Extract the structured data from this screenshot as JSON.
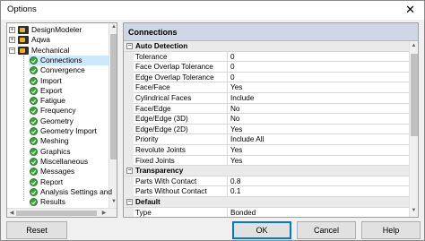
{
  "window": {
    "title": "Options",
    "close_glyph": "✕"
  },
  "tree": {
    "items": [
      {
        "label": "DesignModeler",
        "level": 0,
        "icon": "folder-icon",
        "expander": "+"
      },
      {
        "label": "Aqwa",
        "level": 0,
        "icon": "folder-icon",
        "expander": "+"
      },
      {
        "label": "Mechanical",
        "level": 0,
        "icon": "folder-icon",
        "expander": "−"
      },
      {
        "label": "Connections",
        "level": 1,
        "icon": "check-icon",
        "selected": true
      },
      {
        "label": "Convergence",
        "level": 1,
        "icon": "check-icon"
      },
      {
        "label": "Import",
        "level": 1,
        "icon": "check-icon"
      },
      {
        "label": "Export",
        "level": 1,
        "icon": "check-icon"
      },
      {
        "label": "Fatigue",
        "level": 1,
        "icon": "check-icon"
      },
      {
        "label": "Frequency",
        "level": 1,
        "icon": "check-icon"
      },
      {
        "label": "Geometry",
        "level": 1,
        "icon": "check-icon"
      },
      {
        "label": "Geometry Import",
        "level": 1,
        "icon": "check-icon"
      },
      {
        "label": "Meshing",
        "level": 1,
        "icon": "check-icon"
      },
      {
        "label": "Graphics",
        "level": 1,
        "icon": "check-icon"
      },
      {
        "label": "Miscellaneous",
        "level": 1,
        "icon": "check-icon"
      },
      {
        "label": "Messages",
        "level": 1,
        "icon": "check-icon"
      },
      {
        "label": "Report",
        "level": 1,
        "icon": "check-icon"
      },
      {
        "label": "Analysis Settings and",
        "level": 1,
        "icon": "check-icon"
      },
      {
        "label": "Results",
        "level": 1,
        "icon": "check-icon"
      }
    ]
  },
  "panel": {
    "title": "Connections",
    "rows": [
      {
        "type": "group",
        "label": "Auto Detection",
        "expander": "−"
      },
      {
        "type": "prop",
        "name": "Tolerance",
        "value": "0"
      },
      {
        "type": "prop",
        "name": "Face Overlap Tolerance",
        "value": "0"
      },
      {
        "type": "prop",
        "name": "Edge Overlap Tolerance",
        "value": "0"
      },
      {
        "type": "prop",
        "name": "Face/Face",
        "value": "Yes"
      },
      {
        "type": "prop",
        "name": "Cylindrical Faces",
        "value": "Include"
      },
      {
        "type": "prop",
        "name": "Face/Edge",
        "value": "No"
      },
      {
        "type": "prop",
        "name": "Edge/Edge (3D)",
        "value": "No"
      },
      {
        "type": "prop",
        "name": "Edge/Edge (2D)",
        "value": "Yes"
      },
      {
        "type": "prop",
        "name": "Priority",
        "value": "Include All"
      },
      {
        "type": "prop",
        "name": "Revolute Joints",
        "value": "Yes"
      },
      {
        "type": "prop",
        "name": "Fixed Joints",
        "value": "Yes"
      },
      {
        "type": "group",
        "label": "Transparency",
        "expander": "−"
      },
      {
        "type": "prop",
        "name": "Parts With Contact",
        "value": "0.8"
      },
      {
        "type": "prop",
        "name": "Parts Without Contact",
        "value": "0.1"
      },
      {
        "type": "group",
        "label": "Default",
        "expander": "−"
      },
      {
        "type": "prop",
        "name": "Type",
        "value": "Bonded"
      }
    ]
  },
  "buttons": {
    "reset": "Reset",
    "ok": "OK",
    "cancel": "Cancel",
    "help": "Help"
  },
  "colors": {
    "selection": "#cce8ff",
    "panel_header": "#cfd6e6",
    "check": "#3aa53a",
    "accent_focus": "#0078d7"
  }
}
